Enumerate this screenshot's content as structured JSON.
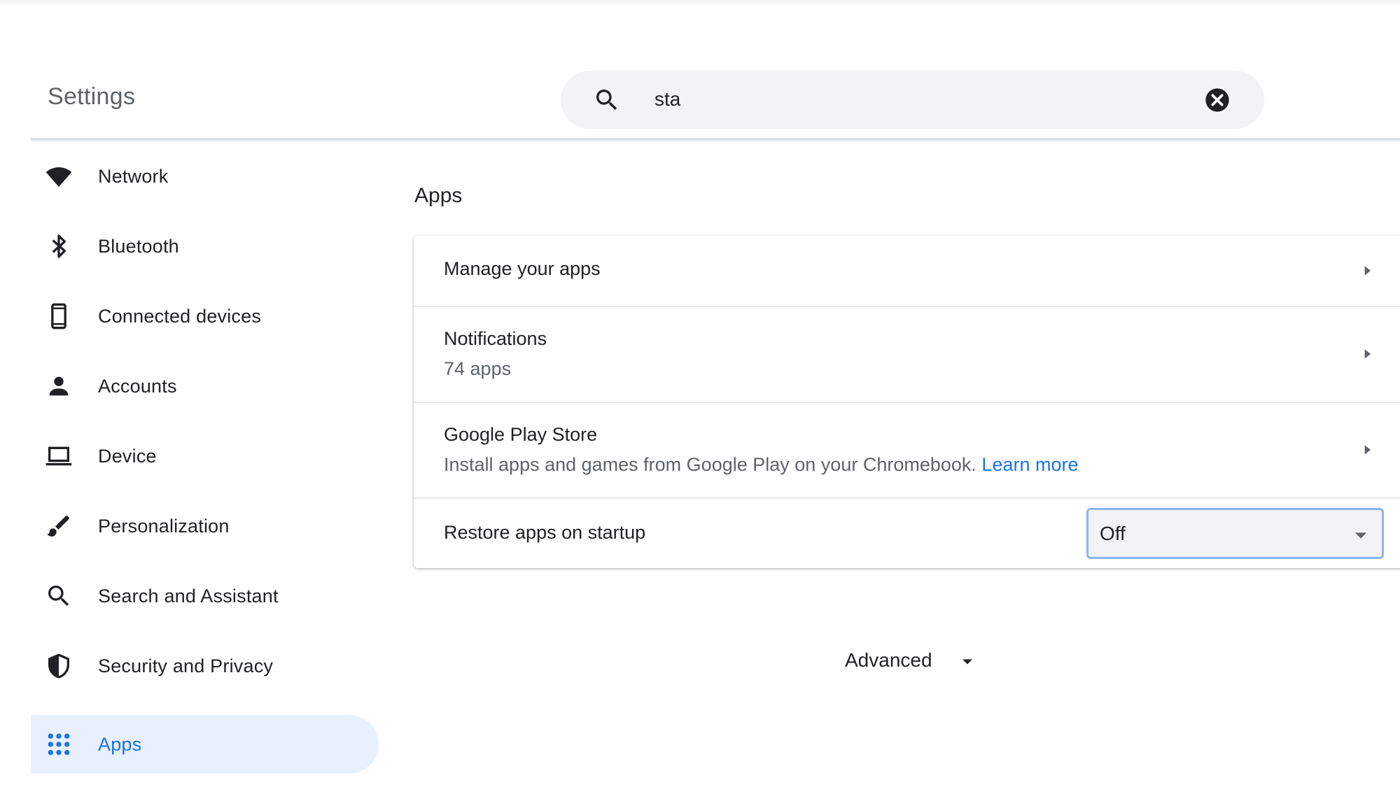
{
  "header": {
    "title": "Settings",
    "search": {
      "value": "sta",
      "icon": "search-icon",
      "clear_icon": "close-icon"
    }
  },
  "sidebar": {
    "items": [
      {
        "label": "Network",
        "icon": "wifi-icon",
        "active": false
      },
      {
        "label": "Bluetooth",
        "icon": "bluetooth-icon",
        "active": false
      },
      {
        "label": "Connected devices",
        "icon": "phone-icon",
        "active": false
      },
      {
        "label": "Accounts",
        "icon": "person-icon",
        "active": false
      },
      {
        "label": "Device",
        "icon": "laptop-icon",
        "active": false
      },
      {
        "label": "Personalization",
        "icon": "brush-icon",
        "active": false
      },
      {
        "label": "Search and Assistant",
        "icon": "search-icon",
        "active": false
      },
      {
        "label": "Security and Privacy",
        "icon": "shield-icon",
        "active": false
      },
      {
        "label": "Apps",
        "icon": "apps-grid-icon",
        "active": true
      }
    ]
  },
  "main": {
    "section_title": "Apps",
    "rows": {
      "manage": {
        "title": "Manage your apps"
      },
      "notifications": {
        "title": "Notifications",
        "subtitle": "74 apps"
      },
      "play_store": {
        "title": "Google Play Store",
        "subtitle": "Install apps and games from Google Play on your Chromebook.",
        "link": "Learn more"
      },
      "restore": {
        "title": "Restore apps on startup",
        "select_value": "Off"
      }
    },
    "advanced_label": "Advanced"
  },
  "colors": {
    "accent": "#1a73e8",
    "active_bg": "#e8f0fe",
    "select_border": "#8ab4f8",
    "search_bg": "#f1f3f4",
    "secondary_text": "#5f6368"
  }
}
